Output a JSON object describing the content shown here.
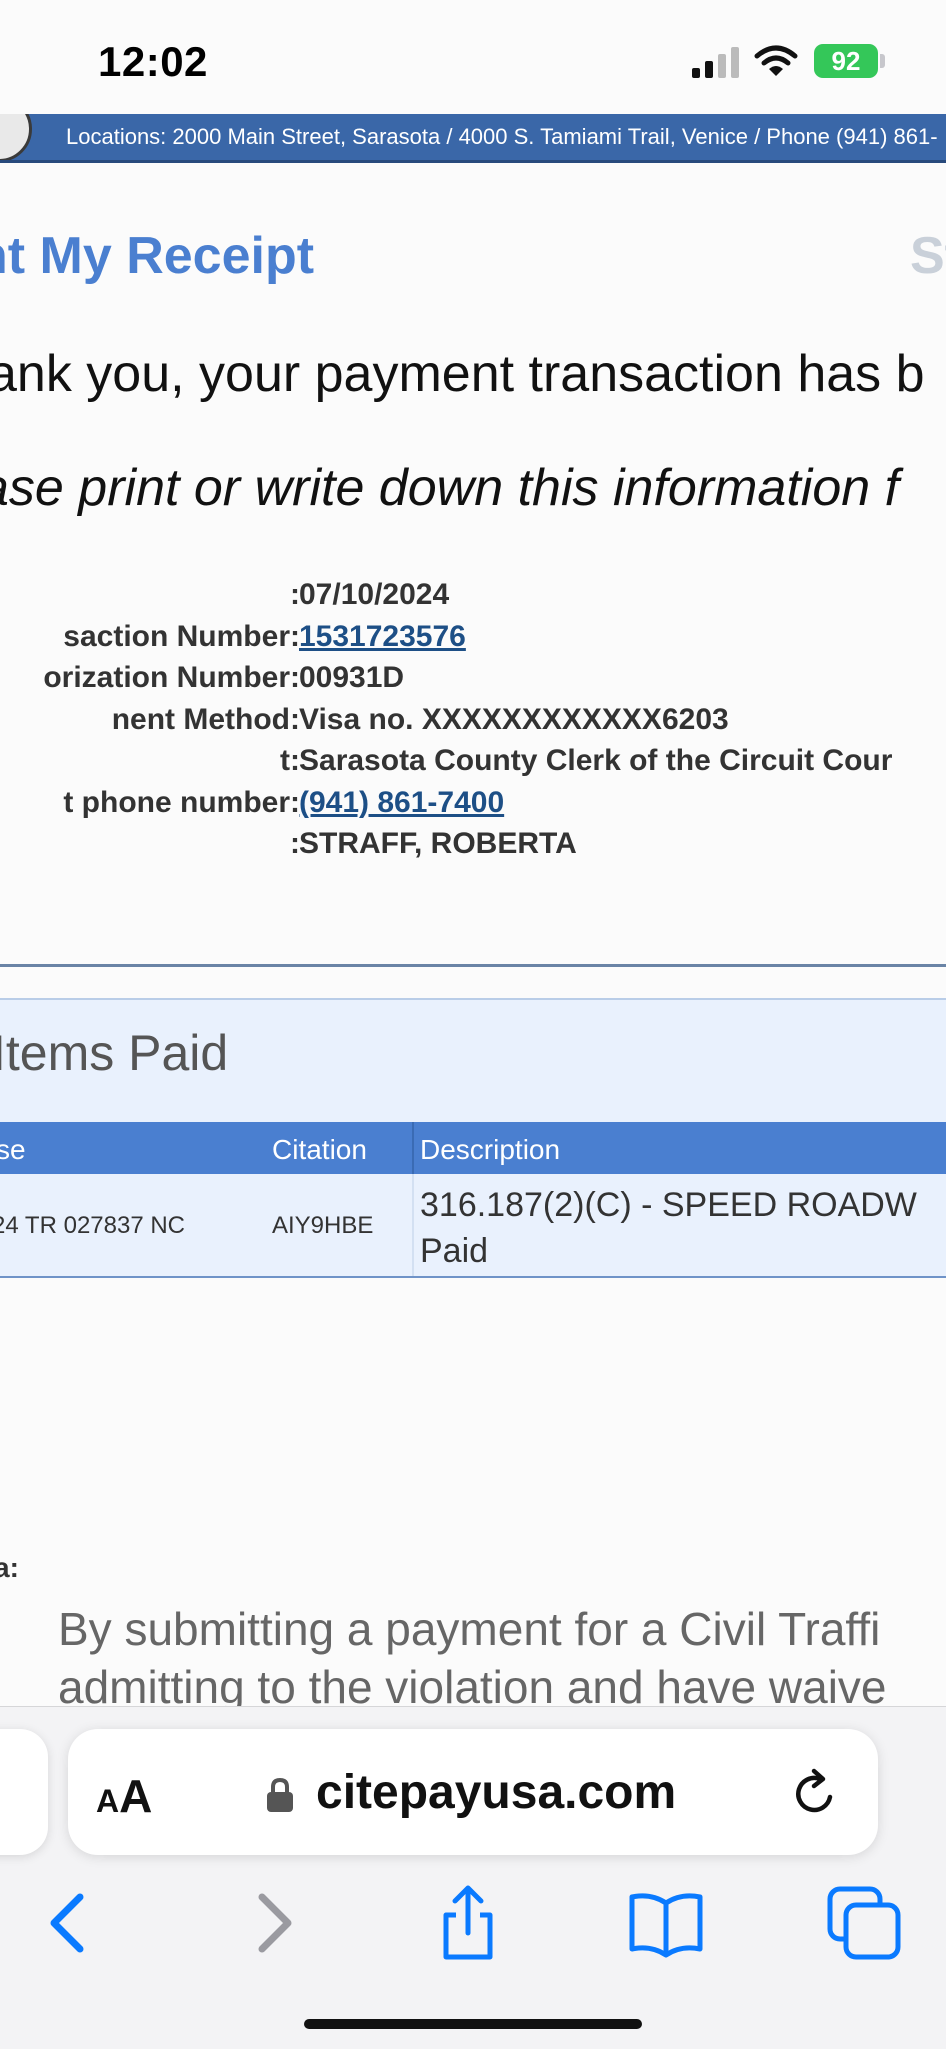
{
  "status_bar": {
    "time": "12:02",
    "battery": "92"
  },
  "banner": {
    "text": "Locations: 2000 Main Street, Sarasota / 4000 S. Tamiami Trail, Venice / Phone (941) 861-"
  },
  "header": {
    "title": "nt My Receipt",
    "right_fragment": "St"
  },
  "messages": {
    "thank_you": "ank you, your payment transaction has b",
    "print_note": "ase print or write down this information f"
  },
  "details": [
    {
      "label": ":",
      "value": "07/10/2024",
      "is_link": false
    },
    {
      "label": "saction Number:",
      "value": "1531723576",
      "is_link": true
    },
    {
      "label": "orization Number:",
      "value": "00931D",
      "is_link": false
    },
    {
      "label": "nent Method:",
      "value": "Visa no. XXXXXXXXXXXX6203",
      "is_link": false
    },
    {
      "label": "t:",
      "value": "Sarasota County Clerk of the Circuit Cour",
      "is_link": false
    },
    {
      "label": "t phone number:",
      "value": "(941) 861-7400",
      "is_link": true
    },
    {
      "label": ":",
      "value": "STRAFF, ROBERTA",
      "is_link": false
    }
  ],
  "items_paid": {
    "title": "Items Paid",
    "headers": {
      "case": "se",
      "citation": "Citation",
      "description": "Description"
    },
    "rows": [
      {
        "case": "24 TR 027837 NC",
        "citation": "AIY9HBE",
        "description_line1": "316.187(2)(C) - SPEED ROADW",
        "description_line2": "Paid"
      }
    ]
  },
  "disclaimer": {
    "label": "a:",
    "line1": "By submitting a payment for a Civil Traffi",
    "line2": "admitting to the violation and have waive"
  },
  "browser": {
    "aa_small": "A",
    "aa_large": "A",
    "url": "citepayusa.com"
  },
  "icons": {
    "signal": "cellular-signal-icon",
    "wifi": "wifi-icon",
    "lock": "lock-icon",
    "reload": "reload-icon",
    "back": "chevron-left-icon",
    "forward": "chevron-right-icon",
    "share": "share-icon",
    "bookmarks": "book-icon",
    "tabs": "tabs-icon"
  },
  "colors": {
    "accent": "#4a7fd0",
    "banner": "#3a67a8",
    "link": "#1d4f86",
    "ios_blue": "#0a7aff",
    "battery": "#34c759"
  }
}
